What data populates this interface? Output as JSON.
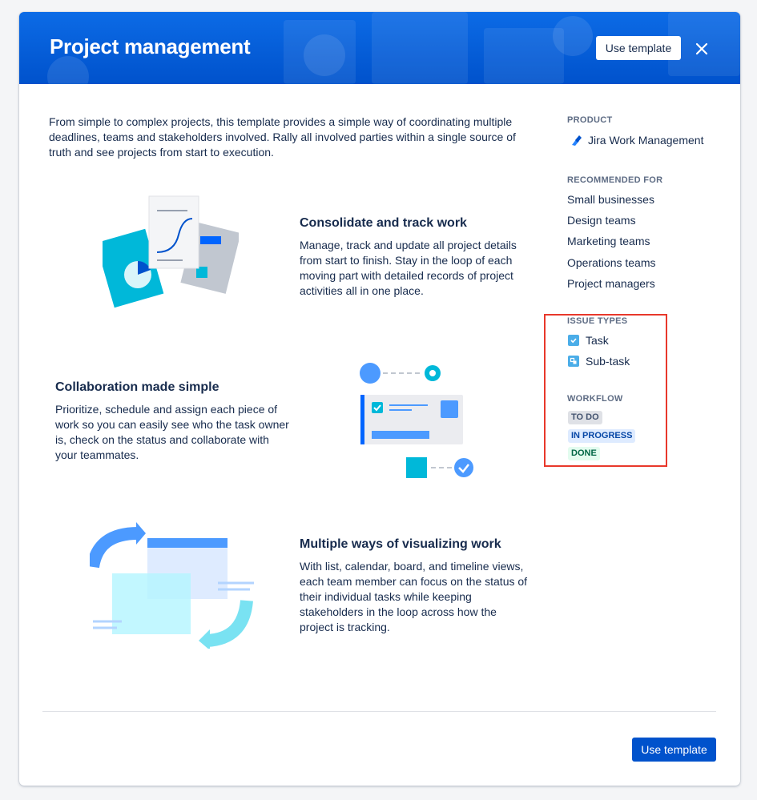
{
  "header": {
    "title": "Project management",
    "use_template_label": "Use template"
  },
  "intro": "From simple to complex projects, this template provides a simple way of coordinating multiple deadlines, teams and stakeholders involved. Rally all involved parties within a single source of truth and see projects from start to execution.",
  "features": [
    {
      "title": "Consolidate and track work",
      "description": "Manage, track and update all project details from start to finish. Stay in the loop of each moving part with detailed records of project activities all in one place."
    },
    {
      "title": "Collaboration made simple",
      "description": "Prioritize, schedule and assign each piece of work so you can easily see who the task owner is, check on the status and collaborate with your teammates."
    },
    {
      "title": "Multiple ways of visualizing work",
      "description": "With list, calendar, board, and timeline views, each team member can focus on the status of their individual tasks while keeping stakeholders in the loop across how the project is tracking."
    }
  ],
  "sidebar": {
    "product_label": "PRODUCT",
    "product_name": "Jira Work Management",
    "product_icon": "jira-work-management-icon",
    "recommended_label": "RECOMMENDED FOR",
    "recommended": [
      "Small businesses",
      "Design teams",
      "Marketing teams",
      "Operations teams",
      "Project managers"
    ],
    "issue_types_label": "ISSUE TYPES",
    "issue_types": [
      {
        "label": "Task",
        "icon": "task-icon"
      },
      {
        "label": "Sub-task",
        "icon": "subtask-icon"
      }
    ],
    "workflow_label": "WORKFLOW",
    "workflow": [
      {
        "label": "TO DO",
        "color": "#dfe1e6",
        "text_color": "#42526e"
      },
      {
        "label": "IN PROGRESS",
        "color": "#deebff",
        "text_color": "#0747a6"
      },
      {
        "label": "DONE",
        "color": "#e3fcef",
        "text_color": "#006644"
      }
    ]
  },
  "footer": {
    "use_template_label": "Use template"
  },
  "colors": {
    "brand": "#0052cc",
    "highlight": "#e8382b"
  }
}
